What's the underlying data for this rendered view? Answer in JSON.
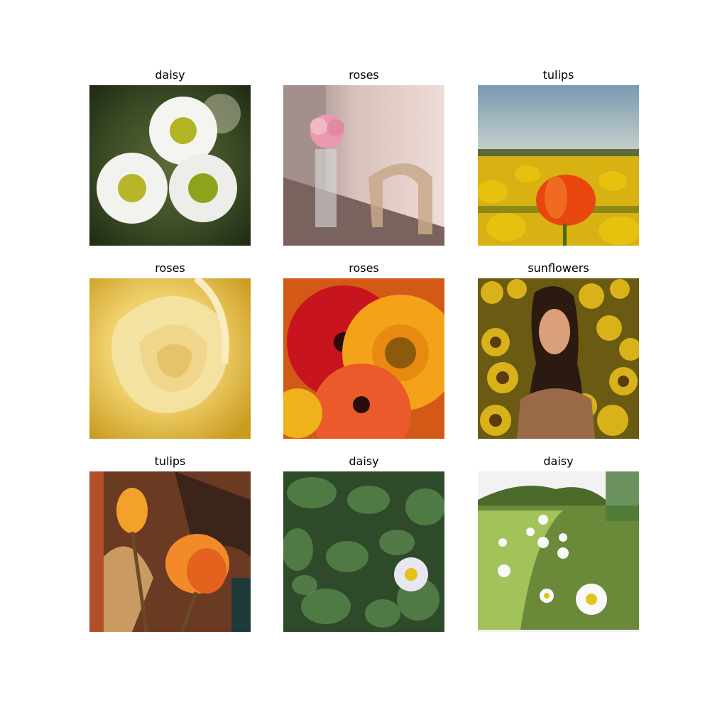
{
  "figure": {
    "panels": [
      {
        "label": "daisy",
        "image": "white daisies with yellow centers on dark green background"
      },
      {
        "label": "roses",
        "image": "pink carnation in glass vase on table by chair"
      },
      {
        "label": "tulips",
        "image": "red tulip in a field of yellow tulips under blue sky"
      },
      {
        "label": "roses",
        "image": "close-up of pale yellow rose petals"
      },
      {
        "label": "roses",
        "image": "red and orange gerbera daisies"
      },
      {
        "label": "sunflowers",
        "image": "woman with dark hair standing in sunflower field"
      },
      {
        "label": "tulips",
        "image": "orange tulips in sepia-toned light"
      },
      {
        "label": "daisy",
        "image": "small white daisy among green leaves"
      },
      {
        "label": "daisy",
        "image": "white daisies in green meadow with hill"
      }
    ]
  }
}
